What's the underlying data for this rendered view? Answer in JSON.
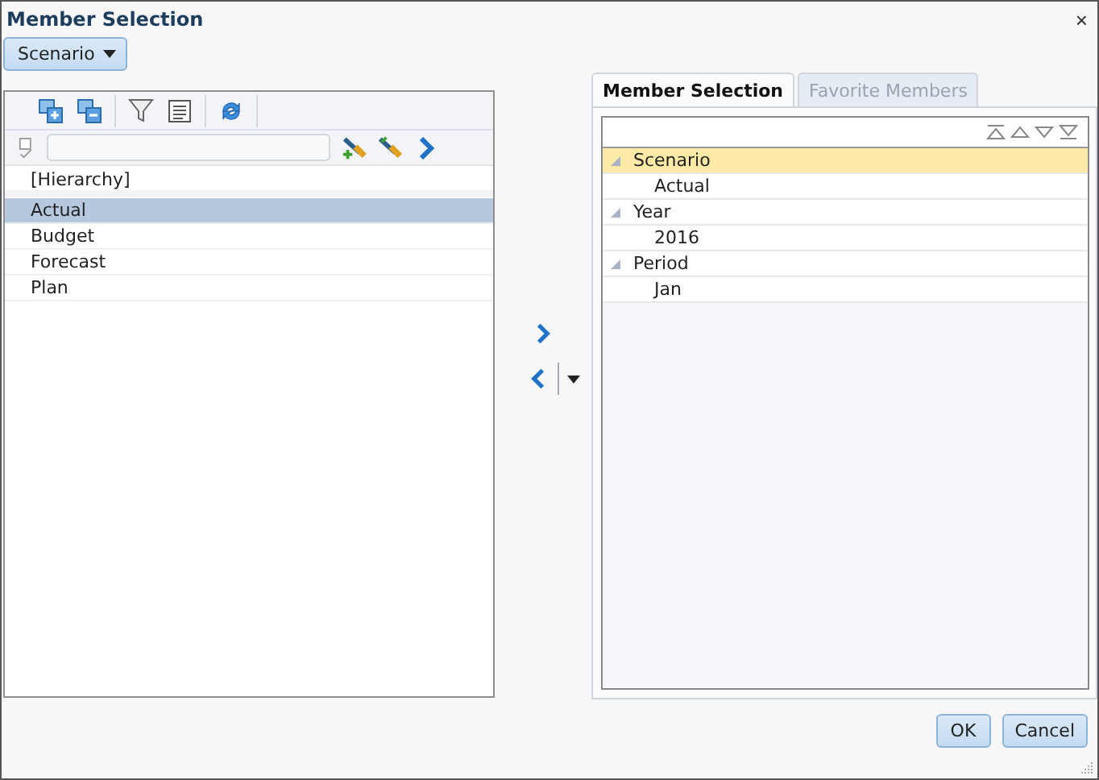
{
  "window": {
    "title": "Member Selection",
    "close": "×"
  },
  "dimension_dropdown": {
    "value": "Scenario"
  },
  "left_panel": {
    "header": "[Hierarchy]",
    "members": [
      {
        "label": "Actual",
        "selected": true
      },
      {
        "label": "Budget",
        "selected": false
      },
      {
        "label": "Forecast",
        "selected": false
      },
      {
        "label": "Plan",
        "selected": false
      }
    ]
  },
  "tabs": [
    {
      "label": "Member Selection",
      "selected": true
    },
    {
      "label": "Favorite Members",
      "selected": false
    }
  ],
  "selection_tree": [
    {
      "label": "Scenario",
      "selected": true,
      "expanded": true,
      "children": [
        {
          "label": "Actual",
          "selected": false
        }
      ]
    },
    {
      "label": "Year",
      "selected": false,
      "expanded": true,
      "children": [
        {
          "label": "2016",
          "selected": false
        }
      ]
    },
    {
      "label": "Period",
      "selected": false,
      "expanded": true,
      "children": [
        {
          "label": "Jan",
          "selected": false
        }
      ]
    }
  ],
  "buttons": [
    {
      "label": "OK"
    },
    {
      "label": "Cancel"
    }
  ]
}
